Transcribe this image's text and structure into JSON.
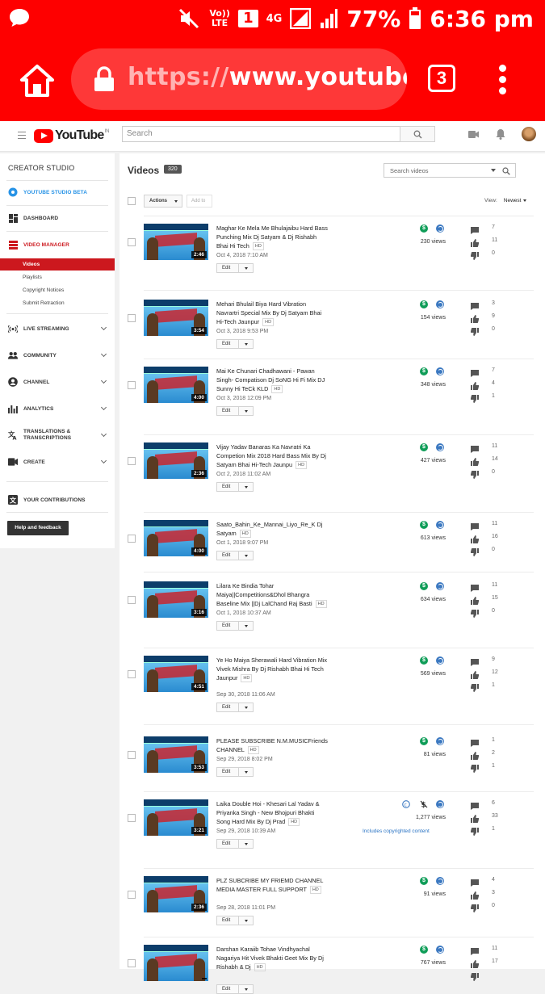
{
  "status_bar": {
    "network": "Vo)) LTE",
    "sim": "1",
    "signal": "4G",
    "battery": "77%",
    "time": "6:36 pm"
  },
  "browser": {
    "url_scheme": "https://",
    "url_host": "www.youtube.com/v",
    "tab_count": "3"
  },
  "yt_header": {
    "logo_text": "YouTube",
    "logo_region": "IN",
    "search_placeholder": "Search"
  },
  "sidebar": {
    "title": "CREATOR STUDIO",
    "items": [
      {
        "label": "YOUTUBE STUDIO BETA",
        "icon": "gear-icon",
        "color": "#2793e6"
      },
      {
        "label": "DASHBOARD",
        "icon": "dashboard-icon"
      },
      {
        "label": "VIDEO MANAGER",
        "icon": "video-manager-icon",
        "color": "#cc181e"
      },
      {
        "label": "LIVE STREAMING",
        "icon": "live-icon"
      },
      {
        "label": "COMMUNITY",
        "icon": "community-icon"
      },
      {
        "label": "CHANNEL",
        "icon": "channel-icon"
      },
      {
        "label": "ANALYTICS",
        "icon": "analytics-icon"
      },
      {
        "label": "TRANSLATIONS & TRANSCRIPTIONS",
        "icon": "translate-icon"
      },
      {
        "label": "CREATE",
        "icon": "camera-icon"
      },
      {
        "label": "YOUR CONTRIBUTIONS",
        "icon": "contributions-icon"
      }
    ],
    "subitems": [
      "Videos",
      "Playlists",
      "Copyright Notices",
      "Submit Retraction"
    ],
    "help_button": "Help and feedback"
  },
  "main": {
    "heading": "Videos",
    "count": "320",
    "search_placeholder": "Search videos",
    "actions_label": "Actions",
    "add_to_label": "Add to",
    "view_label": "View:",
    "sort_label": "Newest",
    "edit_label": "Edit",
    "hd_label": "HD"
  },
  "videos": [
    {
      "title": "Maghar Ke Mela Me Bhulajaibu Hard Bass Punching Mix Dj Satyam & Dj Rishabh Bhai Hi Tech",
      "duration": "2:46",
      "date": "Oct 4, 2018 7:10 AM",
      "views": "230 views",
      "comments": "7",
      "likes": "11",
      "dislikes": "0"
    },
    {
      "title": "Mehari Bhulail Biya Hard Vibration Navrartri Special Mix By Dj Satyam Bhai Hi-Tech Jaunpur",
      "duration": "3:54",
      "date": "Oct 3, 2018 9:53 PM",
      "views": "154 views",
      "comments": "3",
      "likes": "9",
      "dislikes": "0"
    },
    {
      "title": "Mai Ke Chunari Chadhawani - Pawan Singh- Compatison Dj SoNG Hi Fi Mix DJ Sunny Hi TeCk KLD",
      "duration": "4:00",
      "date": "Oct 3, 2018 12:09 PM",
      "views": "348 views",
      "comments": "7",
      "likes": "4",
      "dislikes": "1"
    },
    {
      "title": "Vijay Yadav Banaras Ka Navratri Ka Competion Mix 2018 Hard Bass Mix By Dj Satyam Bhai Hi-Tech Jaunpu",
      "duration": "2:36",
      "date": "Oct 2, 2018 11:02 AM",
      "views": "427 views",
      "comments": "11",
      "likes": "14",
      "dislikes": "0"
    },
    {
      "title": "Saato_Bahin_Ke_Mannai_Liyo_Re_K Dj Satyam",
      "duration": "4:00",
      "date": "Oct 1, 2018 9:07 PM",
      "views": "613 views",
      "comments": "11",
      "likes": "16",
      "dislikes": "0"
    },
    {
      "title": "Lilara Ke Bindia Tohar Maiya||Competitions&Dhol Bhangra Baseline Mix ||Dj LalChand Raj Basti",
      "duration": "3:16",
      "date": "Oct 1, 2018 10:37 AM",
      "views": "634 views",
      "comments": "11",
      "likes": "15",
      "dislikes": "0"
    },
    {
      "title": "Ye Ho Maiya Sherawali Hard Vibration Mix Vivek Mishra By Dj Rishabh Bhai Hi Tech Jaunpur",
      "duration": "4:51",
      "date": "Sep 30, 2018 11:06 AM",
      "views": "569 views",
      "comments": "9",
      "likes": "12",
      "dislikes": "1"
    },
    {
      "title": "PLEASE SUBSCRIBE N.M.MUSICFriends CHANNEL",
      "duration": "3:53",
      "date": "Sep 29, 2018 8:02 PM",
      "views": "81 views",
      "comments": "1",
      "likes": "2",
      "dislikes": "1"
    },
    {
      "title": "Laika Double Hoi - Khesari Lal Yadav & Priyanka Singh - New Bhojpuri Bhakti Song Hard Mix By Dj Prad",
      "duration": "3:21",
      "date": "Sep 29, 2018 10:39 AM",
      "views": "1,277 views",
      "comments": "6",
      "likes": "33",
      "dislikes": "1",
      "copyright": "Includes copyrighted content"
    },
    {
      "title": "PLZ SUBCRIBE MY FRIEMD CHANNEL MEDIA MASTER FULL SUPPORT",
      "duration": "2:36",
      "date": "Sep 28, 2018 11:01 PM",
      "views": "91 views",
      "comments": "4",
      "likes": "3",
      "dislikes": "0"
    },
    {
      "title": "Darshan Karaiib Tohae Vindhyachal Nagariya Hit Vivek Bhakti Geet Mix By Dj Rishabh & Dj",
      "duration": "",
      "date": "",
      "views": "767 views",
      "comments": "11",
      "likes": "17",
      "dislikes": ""
    }
  ],
  "colors": {
    "browser_red": "#fe0000",
    "yt_red": "#cc181e",
    "monetized_green": "#0f9d58",
    "public_blue": "#3c79c1"
  }
}
